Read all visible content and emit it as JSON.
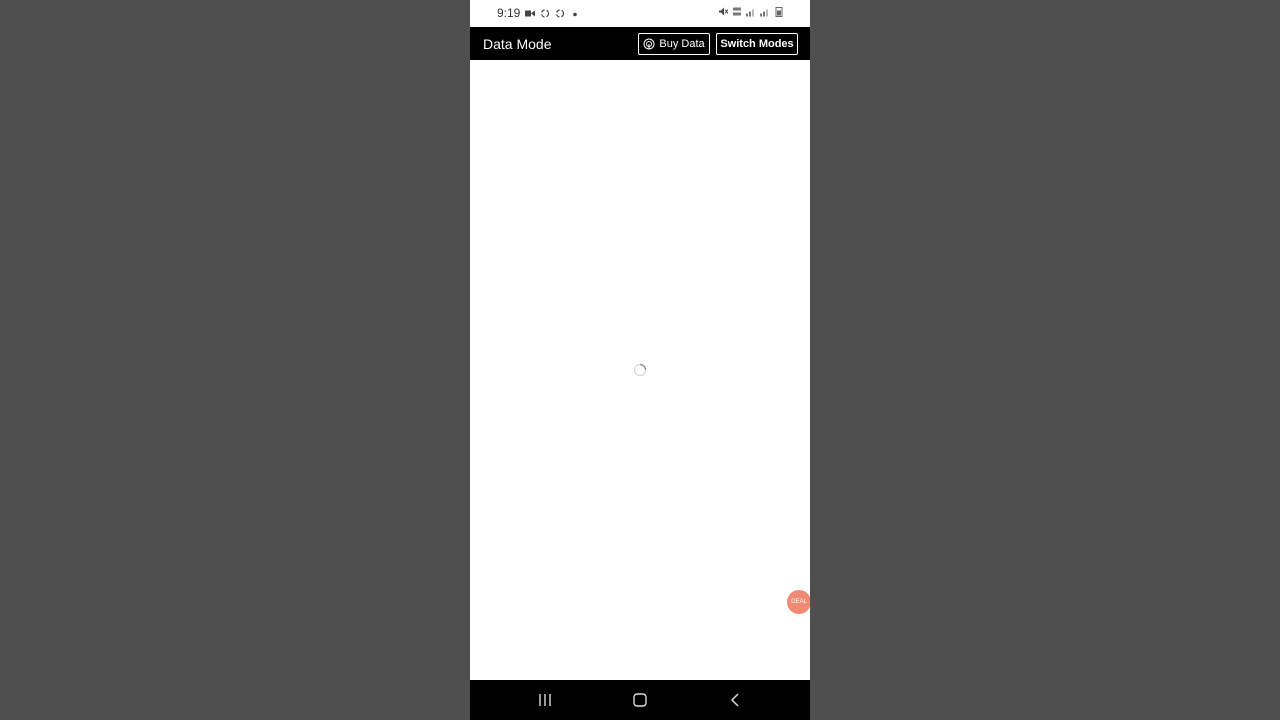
{
  "status_bar": {
    "time": "9:19",
    "icons_left": [
      "video-icon",
      "sync-icon",
      "sync-icon",
      "dot-icon"
    ],
    "icons_right": [
      "mute-icon",
      "4g-icon",
      "signal-icon",
      "signal-icon",
      "battery-icon"
    ]
  },
  "app_bar": {
    "title": "Data Mode",
    "buy_data_label": "Buy Data",
    "switch_modes_label": "Switch Modes"
  },
  "content": {
    "loading": true
  },
  "fab": {
    "label": "DEAL"
  },
  "colors": {
    "background": "#4f4f4f",
    "app_bar": "#000000",
    "fab": "#f18a72"
  }
}
